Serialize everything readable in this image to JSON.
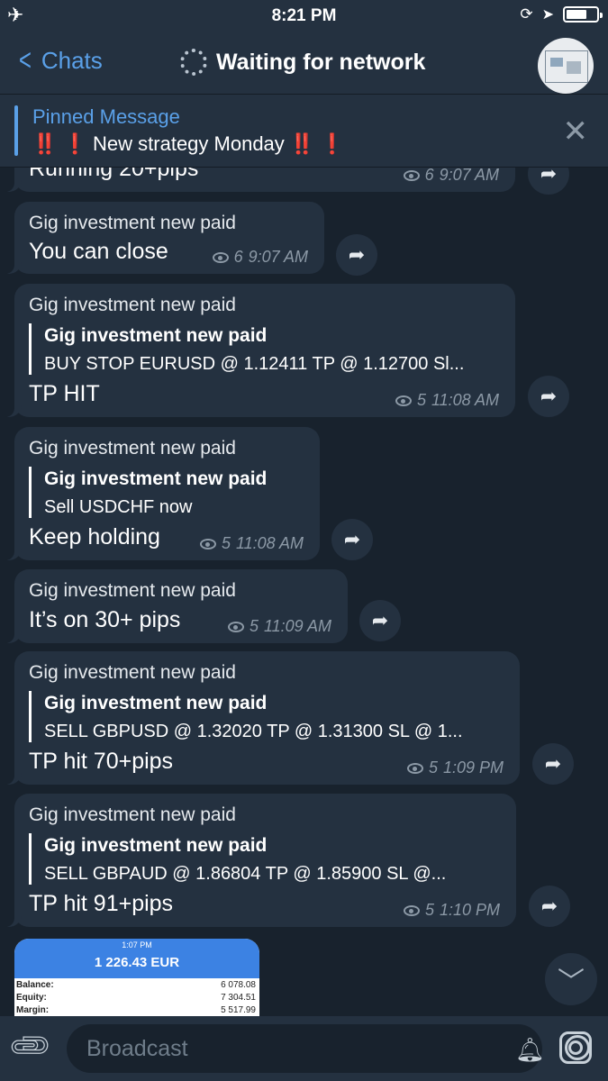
{
  "status": {
    "time": "8:21 PM"
  },
  "nav": {
    "back_label": "Chats",
    "title": "Waiting for network"
  },
  "pinned": {
    "title": "Pinned Message",
    "bangs_left": "‼️ ❗",
    "text": "New strategy Monday",
    "bangs_right": "‼️ ❗"
  },
  "messages": [
    {
      "text": "Running 20+pips",
      "views": "6",
      "time": "9:07 AM"
    },
    {
      "sender": "Gig investment new paid",
      "text": "You can close",
      "views": "6",
      "time": "9:07 AM"
    },
    {
      "sender": "Gig investment new paid",
      "quote_name": "Gig investment new paid",
      "quote_text": "BUY STOP EURUSD @ 1.12411 TP @ 1.12700 Sl...",
      "text": "TP HIT",
      "views": "5",
      "time": "11:08 AM"
    },
    {
      "sender": "Gig investment new paid",
      "quote_name": "Gig investment new paid",
      "quote_text": "Sell USDCHF now",
      "text": "Keep holding",
      "views": "5",
      "time": "11:08 AM"
    },
    {
      "sender": "Gig investment new paid",
      "text": "It’s on 30+ pips",
      "views": "5",
      "time": "11:09 AM"
    },
    {
      "sender": "Gig investment new paid",
      "quote_name": "Gig investment new paid",
      "quote_text": "SELL GBPUSD @ 1.32020 TP @ 1.31300 SL @ 1...",
      "text": "TP hit 70+pips",
      "views": "5",
      "time": "1:09 PM"
    },
    {
      "sender": "Gig investment new paid",
      "quote_name": "Gig investment new paid",
      "quote_text": "SELL GBPAUD @ 1.86804  TP @ 1.85900 SL @...",
      "text": "TP hit 91+pips",
      "views": "5",
      "time": "1:10 PM"
    }
  ],
  "image_message": {
    "time": "1:07 PM",
    "value": "1 226.43 EUR",
    "rows": [
      {
        "label": "Balance:",
        "value": "6 078.08"
      },
      {
        "label": "Equity:",
        "value": "7 304.51"
      },
      {
        "label": "Margin:",
        "value": "5 517.99"
      }
    ]
  },
  "input": {
    "placeholder": "Broadcast"
  }
}
